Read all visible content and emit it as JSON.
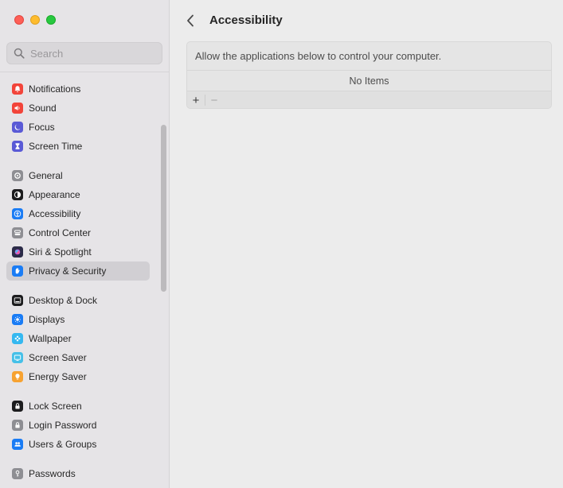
{
  "window": {
    "traffic_lights": {
      "close": "#fe5f57",
      "minimize": "#febc2e",
      "maximize": "#28c840"
    }
  },
  "search": {
    "placeholder": "Search",
    "icon": "magnifying-glass-icon"
  },
  "sidebar": {
    "groups": [
      {
        "items": [
          {
            "label": "Notifications",
            "icon": "bell-icon",
            "color": "#f2443a"
          },
          {
            "label": "Sound",
            "icon": "speaker-icon",
            "color": "#f2443a"
          },
          {
            "label": "Focus",
            "icon": "moon-icon",
            "color": "#5a5ad6"
          },
          {
            "label": "Screen Time",
            "icon": "hourglass-icon",
            "color": "#5a5ad6"
          }
        ]
      },
      {
        "items": [
          {
            "label": "General",
            "icon": "gear-icon",
            "color": "#8e8e93"
          },
          {
            "label": "Appearance",
            "icon": "appearance-icon",
            "color": "#1c1c1e"
          },
          {
            "label": "Accessibility",
            "icon": "accessibility-icon",
            "color": "#1a7cf5"
          },
          {
            "label": "Control Center",
            "icon": "control-center-icon",
            "color": "#8e8e93"
          },
          {
            "label": "Siri & Spotlight",
            "icon": "siri-icon",
            "color": "#2b2b48"
          },
          {
            "label": "Privacy & Security",
            "icon": "hand-icon",
            "color": "#1a7cf5",
            "selected": true
          }
        ]
      },
      {
        "items": [
          {
            "label": "Desktop & Dock",
            "icon": "dock-icon",
            "color": "#1c1c1e"
          },
          {
            "label": "Displays",
            "icon": "sun-icon",
            "color": "#1a7cf5"
          },
          {
            "label": "Wallpaper",
            "icon": "flower-icon",
            "color": "#35b8f0"
          },
          {
            "label": "Screen Saver",
            "icon": "screen-saver-icon",
            "color": "#46c0e8"
          },
          {
            "label": "Energy Saver",
            "icon": "lightbulb-icon",
            "color": "#f7a231"
          }
        ]
      },
      {
        "items": [
          {
            "label": "Lock Screen",
            "icon": "lock-icon",
            "color": "#1c1c1e"
          },
          {
            "label": "Login Password",
            "icon": "padlock-icon",
            "color": "#8e8e93"
          },
          {
            "label": "Users & Groups",
            "icon": "users-icon",
            "color": "#1a7cf5"
          }
        ]
      },
      {
        "items": [
          {
            "label": "Passwords",
            "icon": "key-icon",
            "color": "#8e8e93"
          }
        ]
      }
    ]
  },
  "main": {
    "title": "Accessibility",
    "panel": {
      "description": "Allow the applications below to control your computer.",
      "empty_text": "No Items",
      "add_label": "+",
      "remove_label": "−"
    }
  }
}
